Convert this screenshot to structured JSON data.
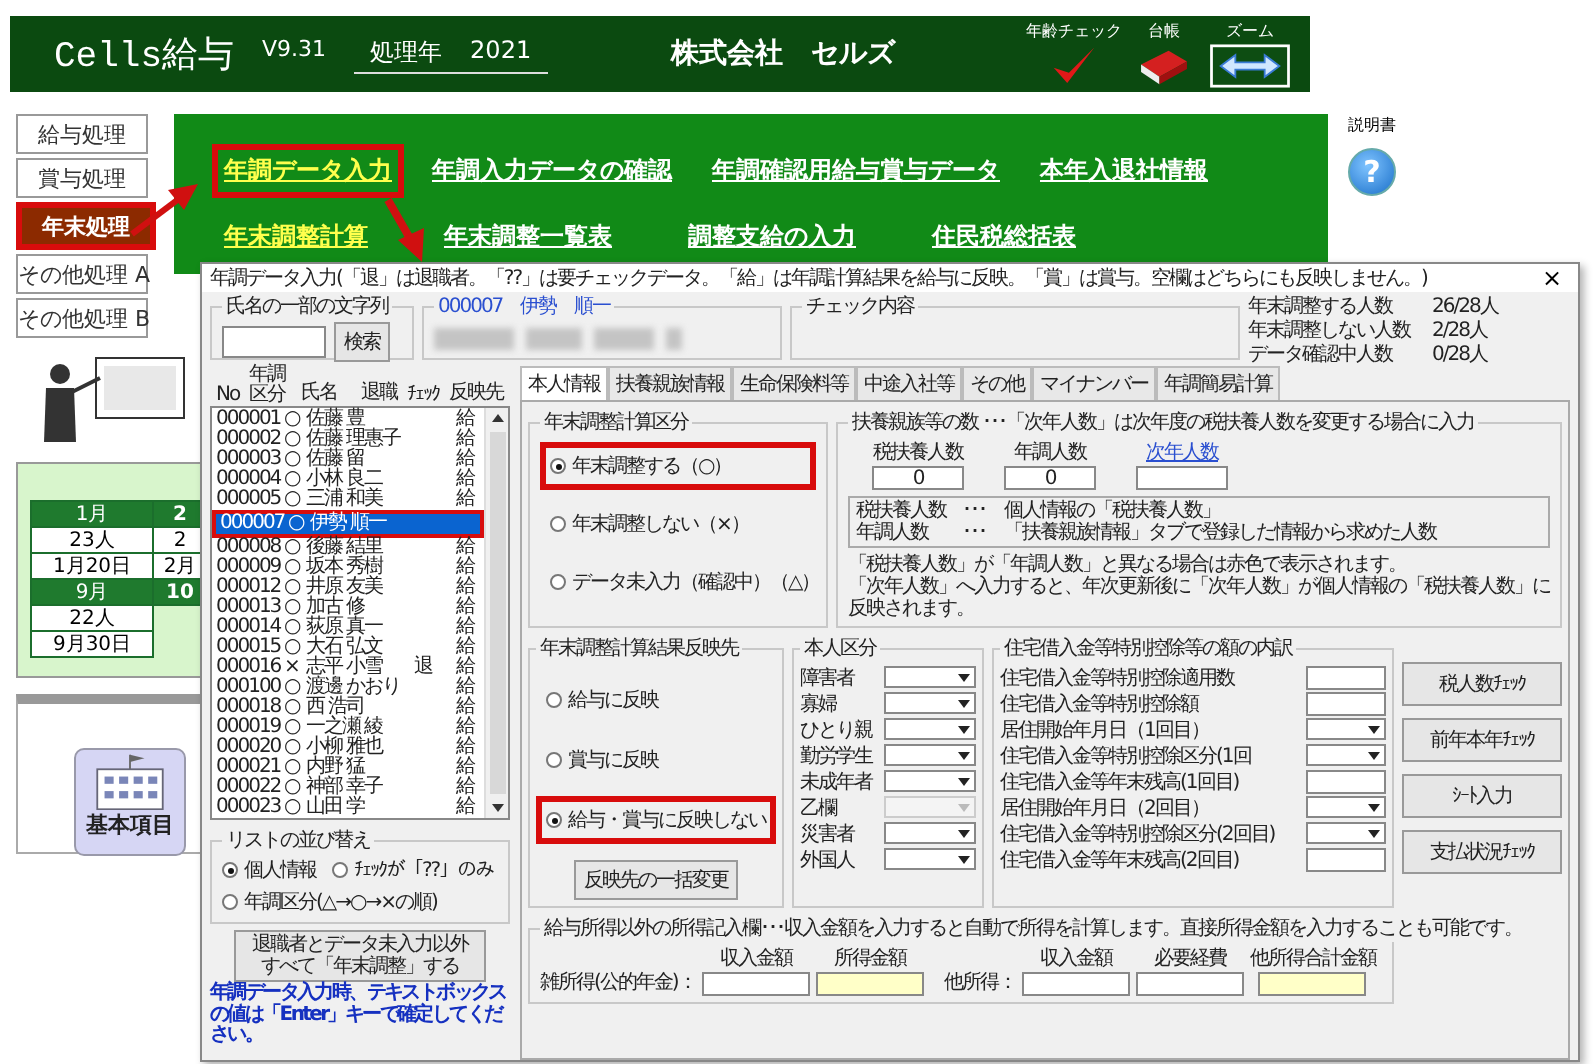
{
  "app": {
    "logo": "Cells給与",
    "version": "V9.31",
    "year_label": "処理年",
    "year": "2021",
    "company": "株式会社　セルズ",
    "tools": [
      {
        "kind": "check",
        "label": "年齢チェック"
      },
      {
        "kind": "ledger",
        "label": "台帳"
      },
      {
        "kind": "zoom",
        "label": "ズーム"
      }
    ]
  },
  "menu": [
    {
      "label": "給与処理",
      "selected": false
    },
    {
      "label": "賞与処理",
      "selected": false
    },
    {
      "label": "年末処理",
      "selected": true
    },
    {
      "label": "その他処理 A",
      "selected": false
    },
    {
      "label": "その他処理 B",
      "selected": false
    }
  ],
  "links": [
    [
      {
        "label": "年調データ入力",
        "kind": "primary",
        "highlighted": true
      },
      {
        "label": "年調入力データの確認",
        "kind": "normal",
        "highlighted": false
      },
      {
        "label": "年調確認用給与賞与データ",
        "kind": "normal",
        "highlighted": false
      },
      {
        "label": "本年入退社情報",
        "kind": "normal",
        "highlighted": false
      }
    ],
    [
      {
        "label": "年末調整計算",
        "kind": "primary",
        "highlighted": false
      },
      {
        "label": "年末調整一覧表",
        "kind": "normal",
        "highlighted": false
      },
      {
        "label": "調整支給の入力",
        "kind": "normal",
        "highlighted": false
      },
      {
        "label": "住民税総括表",
        "kind": "normal",
        "highlighted": false
      }
    ]
  ],
  "help": {
    "label": "説明書",
    "icon": "?"
  },
  "calendar": [
    {
      "kind": "month",
      "cells": [
        "1月",
        "2"
      ]
    },
    {
      "kind": "count",
      "cells": [
        "23人",
        "2"
      ]
    },
    {
      "kind": "date",
      "cells": [
        "1月20日",
        "2月"
      ]
    },
    {
      "kind": "month",
      "cells": [
        "9月",
        "10"
      ]
    },
    {
      "kind": "count",
      "cells": [
        "22人"
      ]
    },
    {
      "kind": "date",
      "cells": [
        "9月30日"
      ]
    }
  ],
  "shortcut": {
    "label": "基本項目"
  },
  "dialog": {
    "title": "年調データ入力(「退」は退職者。「??」は要チェックデータ。「給」は年調計算結果を給与に反映。「賞」は賞与。空欄はどちらにも反映しません。)",
    "close": "×",
    "search": {
      "legend": "氏名の一部の文字列",
      "button": "検索"
    },
    "employee": {
      "legend": "000007　伊勢　順一"
    },
    "check": {
      "legend": "チェック内容"
    },
    "stats": [
      {
        "label": "年末調整する人数",
        "value": "26/28人"
      },
      {
        "label": "年末調整しない人数",
        "value": "2/28人"
      },
      {
        "label": "データ確認中人数",
        "value": "0/28人"
      }
    ],
    "list": {
      "columns": [
        "No",
        "年調区分",
        "氏名",
        "退職",
        "ﾁｪｯｸ",
        "反映先"
      ],
      "rows": [
        {
          "no": "000001",
          "mark": "○",
          "name": "佐藤 豊",
          "target": "給",
          "selected": false,
          "highlighted": false
        },
        {
          "no": "000002",
          "mark": "○",
          "name": "佐藤 理惠子",
          "target": "給",
          "selected": false,
          "highlighted": false
        },
        {
          "no": "000003",
          "mark": "○",
          "name": "佐藤 留",
          "target": "給",
          "selected": false,
          "highlighted": false
        },
        {
          "no": "000004",
          "mark": "○",
          "name": "小林 良二",
          "target": "給",
          "selected": false,
          "highlighted": false
        },
        {
          "no": "000005",
          "mark": "○",
          "name": "三浦 和美",
          "target": "給",
          "selected": false,
          "highlighted": false
        },
        {
          "no": "000007",
          "mark": "○",
          "name": "伊勢 順一",
          "selected": true,
          "highlighted": true
        },
        {
          "no": "000008",
          "mark": "○",
          "name": "後藤 結里",
          "target": "給",
          "selected": false,
          "highlighted": false
        },
        {
          "no": "000009",
          "mark": "○",
          "name": "坂本 秀樹",
          "target": "給",
          "selected": false,
          "highlighted": false
        },
        {
          "no": "000012",
          "mark": "○",
          "name": "井原 友美",
          "target": "給",
          "selected": false,
          "highlighted": false
        },
        {
          "no": "000013",
          "mark": "○",
          "name": "加古 修",
          "target": "給",
          "selected": false,
          "highlighted": false
        },
        {
          "no": "000014",
          "mark": "○",
          "name": "荻原 真一",
          "target": "給",
          "selected": false,
          "highlighted": false
        },
        {
          "no": "000015",
          "mark": "○",
          "name": "大石 弘文",
          "target": "給",
          "selected": false,
          "highlighted": false
        },
        {
          "no": "000016",
          "mark": "×",
          "name": "志平 小雪",
          "retired": "退",
          "target": "給",
          "selected": false,
          "highlighted": false
        },
        {
          "no": "000100",
          "mark": "○",
          "name": "渡邊 かおり",
          "target": "給",
          "selected": false,
          "highlighted": false
        },
        {
          "no": "000018",
          "mark": "○",
          "name": "西 浩司",
          "target": "給",
          "selected": false,
          "highlighted": false
        },
        {
          "no": "000019",
          "mark": "○",
          "name": "一之瀬 綾",
          "target": "給",
          "selected": false,
          "highlighted": false
        },
        {
          "no": "000020",
          "mark": "○",
          "name": "小柳 雅也",
          "target": "給",
          "selected": false,
          "highlighted": false
        },
        {
          "no": "000021",
          "mark": "○",
          "name": "内野 猛",
          "target": "給",
          "selected": false,
          "highlighted": false
        },
        {
          "no": "000022",
          "mark": "○",
          "name": "神部 幸子",
          "target": "給",
          "selected": false,
          "highlighted": false
        },
        {
          "no": "000023",
          "mark": "○",
          "name": "山田 学",
          "target": "給",
          "selected": false,
          "highlighted": false
        }
      ]
    },
    "sort": {
      "legend": "リストの並び替え",
      "options": [
        {
          "label": "個人情報",
          "selected": true
        },
        {
          "label": "ﾁｪｯｸが「??」のみ",
          "selected": false
        },
        {
          "label": "年調区分(△→○→×の順)",
          "selected": false
        }
      ]
    },
    "bulk_button": "退職者とデータ未入力以外すべて「年末調整」する",
    "note": "年調データ入力時、テキストボックスの値は「Enter」キーで確定してください。",
    "tabs": [
      {
        "label": "本人情報",
        "selected": true
      },
      {
        "label": "扶養親族情報",
        "selected": false
      },
      {
        "label": "生命保険料等",
        "selected": false
      },
      {
        "label": "中途入社等",
        "selected": false
      },
      {
        "label": "その他",
        "selected": false
      },
      {
        "label": "マイナンバー",
        "selected": false
      },
      {
        "label": "年調簡易計算",
        "selected": false
      }
    ],
    "calc_type": {
      "legend": "年末調整計算区分",
      "options": [
        {
          "label": "年末調整する（○）",
          "selected": true,
          "highlighted": true
        },
        {
          "label": "年末調整しない（×）",
          "selected": false,
          "highlighted": false
        },
        {
          "label": "データ未入力（確認中）（△）",
          "selected": false,
          "highlighted": false
        }
      ]
    },
    "dependents": {
      "legend": "扶養親族等の数 ･･･「次年人数」は次年度の税扶養人数を変更する場合に入力",
      "fields": [
        {
          "label": "税扶養人数",
          "kind": "value",
          "value": "0"
        },
        {
          "label": "年調人数",
          "kind": "value",
          "value": "0"
        },
        {
          "label": "次年人数",
          "kind": "link"
        }
      ],
      "info": [
        {
          "term": "税扶養人数",
          "desc": "･･･　個人情報の「税扶養人数」"
        },
        {
          "term": "年調人数",
          "desc": "･･･　「扶養親族情報」タブで登録した情報から求めた人数"
        }
      ],
      "notes": [
        "「税扶養人数」が「年調人数」と異なる場合は赤色で表示されます。",
        "「次年人数」へ入力すると、年次更新後に「次年人数」が個人情報の「税扶養人数」に反映されます。"
      ]
    },
    "target": {
      "legend": "年末調整計算結果反映先",
      "options": [
        {
          "label": "給与に反映",
          "selected": false,
          "highlighted": false
        },
        {
          "label": "賞与に反映",
          "selected": false,
          "highlighted": false
        },
        {
          "label": "給与・賞与に反映しない",
          "selected": true,
          "highlighted": true
        }
      ],
      "button": "反映先の一括変更"
    },
    "category": {
      "legend": "本人区分",
      "items": [
        {
          "label": "障害者",
          "disabled": false
        },
        {
          "label": "寡婦",
          "disabled": false
        },
        {
          "label": "ひとり親",
          "disabled": false
        },
        {
          "label": "勤労学生",
          "disabled": false
        },
        {
          "label": "未成年者",
          "disabled": false
        },
        {
          "label": "乙欄",
          "disabled": true
        },
        {
          "label": "災害者",
          "disabled": false
        },
        {
          "label": "外国人",
          "disabled": false
        }
      ]
    },
    "housing": {
      "legend": "住宅借入金等特別控除等の額の内訳",
      "items": [
        {
          "label": "住宅借入金等特別控除適用数",
          "kind": "text"
        },
        {
          "label": "住宅借入金等特別控除額",
          "kind": "text"
        },
        {
          "label": "居住開始年月日（1回目）",
          "kind": "select"
        },
        {
          "label": "住宅借入金等特別控除区分(1回",
          "kind": "select"
        },
        {
          "label": "住宅借入金等年末残高(1回目)",
          "kind": "text"
        },
        {
          "label": "居住開始年月日（2回目）",
          "kind": "select"
        },
        {
          "label": "住宅借入金等特別控除区分(2回目)",
          "kind": "select"
        },
        {
          "label": "住宅借入金等年末残高(2回目)",
          "kind": "text"
        }
      ]
    },
    "side_buttons": [
      "税人数ﾁｪｯｸ",
      "前年本年ﾁｪｯｸ",
      "ｼｰﾄ入力",
      "支払状況ﾁｪｯｸ"
    ],
    "other_income": {
      "legend": "給与所得以外の所得記入欄･･･収入金額を入力すると自動で所得を計算します。直接所得金額を入力することも可能です。",
      "blocks": [
        {
          "label": "雑所得(公的年金)：",
          "columns": [
            {
              "label": "収入金額",
              "kind": "input"
            },
            {
              "label": "所得金額",
              "kind": "computed"
            }
          ]
        },
        {
          "label": "他所得：",
          "columns": [
            {
              "label": "収入金額",
              "kind": "input"
            },
            {
              "label": "必要経費",
              "kind": "input"
            },
            {
              "label": "他所得合計金額",
              "kind": "computed"
            }
          ]
        }
      ]
    }
  }
}
